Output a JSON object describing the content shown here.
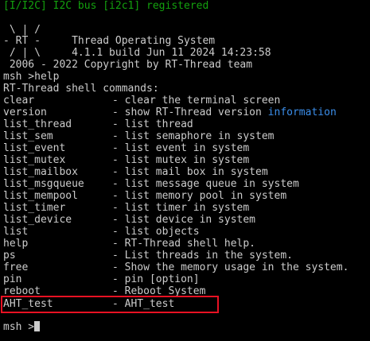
{
  "header": {
    "i2c_line": "[I/I2C] I2C bus [i2c1] registered"
  },
  "banner": {
    "logo_line1": " \\ | /",
    "logo_line2": "- RT -     Thread Operating System",
    "logo_line3": " / | \\     4.1.1 build Jun 11 2024 14:23:58",
    "copyright": " 2006 - 2022 Copyright by RT-Thread team"
  },
  "session": {
    "help_cmd": "msh >help",
    "commands_title": "RT-Thread shell commands:",
    "prompt": "msh >"
  },
  "commands": [
    {
      "name": "clear",
      "desc": "- clear the terminal screen"
    },
    {
      "name": "version",
      "desc": "- show RT-Thread version ",
      "desc_link": "information"
    },
    {
      "name": "list_thread",
      "desc": "- list thread"
    },
    {
      "name": "list_sem",
      "desc": "- list semaphore in system"
    },
    {
      "name": "list_event",
      "desc": "- list event in system"
    },
    {
      "name": "list_mutex",
      "desc": "- list mutex in system"
    },
    {
      "name": "list_mailbox",
      "desc": "- list mail box in system"
    },
    {
      "name": "list_msgqueue",
      "desc": "- list message queue in system"
    },
    {
      "name": "list_mempool",
      "desc": "- list memory pool in system"
    },
    {
      "name": "list_timer",
      "desc": "- list timer in system"
    },
    {
      "name": "list_device",
      "desc": "- list device in system"
    },
    {
      "name": "list",
      "desc": "- list objects"
    },
    {
      "name": "help",
      "desc": "- RT-Thread shell help."
    },
    {
      "name": "ps",
      "desc": "- List threads in the system."
    },
    {
      "name": "free",
      "desc": "- Show the memory usage in the system."
    },
    {
      "name": "pin",
      "desc": "- pin [option]"
    },
    {
      "name": "reboot",
      "desc": "- Reboot System"
    },
    {
      "name": "AHT_test",
      "desc": "- AHT_test"
    }
  ],
  "colors": {
    "background": "#000000",
    "text": "#cccccc",
    "log_green": "#13a10e",
    "link_blue": "#3b8eea",
    "highlight_red": "#e81123"
  }
}
